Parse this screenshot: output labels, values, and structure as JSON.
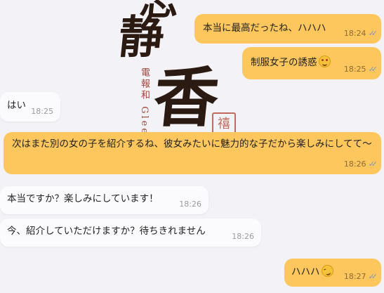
{
  "messages": [
    {
      "dir": "out",
      "text": "本当に最高だったね、ハハハ",
      "time": "18:24",
      "emoji": ""
    },
    {
      "dir": "out",
      "text": "制服女子の誘惑",
      "time": "18:25",
      "emoji": "star-struck-emoji"
    },
    {
      "dir": "in",
      "text": "はい",
      "time": "18:25",
      "emoji": ""
    },
    {
      "dir": "out",
      "text": "次はまた別の女の子を紹介するね、彼女みたいに魅力的な子だから楽しみにしてて～",
      "time": "18:26",
      "emoji": ""
    },
    {
      "dir": "in",
      "text": "本当ですか？楽しみにしています！",
      "time": "18:26",
      "emoji": ""
    },
    {
      "dir": "in",
      "text": "今、紹介していただけますか？待ちきれません",
      "time": "18:26",
      "emoji": ""
    },
    {
      "dir": "out",
      "text": "ハハハ",
      "time": "18:27",
      "emoji": "rofl-emoji"
    }
  ],
  "wallpaper": {
    "char_top": "志",
    "char_1": "静",
    "char_2": "香",
    "vertical_text": "電報和 Gleez 9",
    "seal": "禧"
  },
  "colors": {
    "outgoing_bubble": "#fdc75e",
    "incoming_bubble": "#fbfbfd",
    "read_ticks": "#7d96c8",
    "background": "#f3f2f7"
  }
}
